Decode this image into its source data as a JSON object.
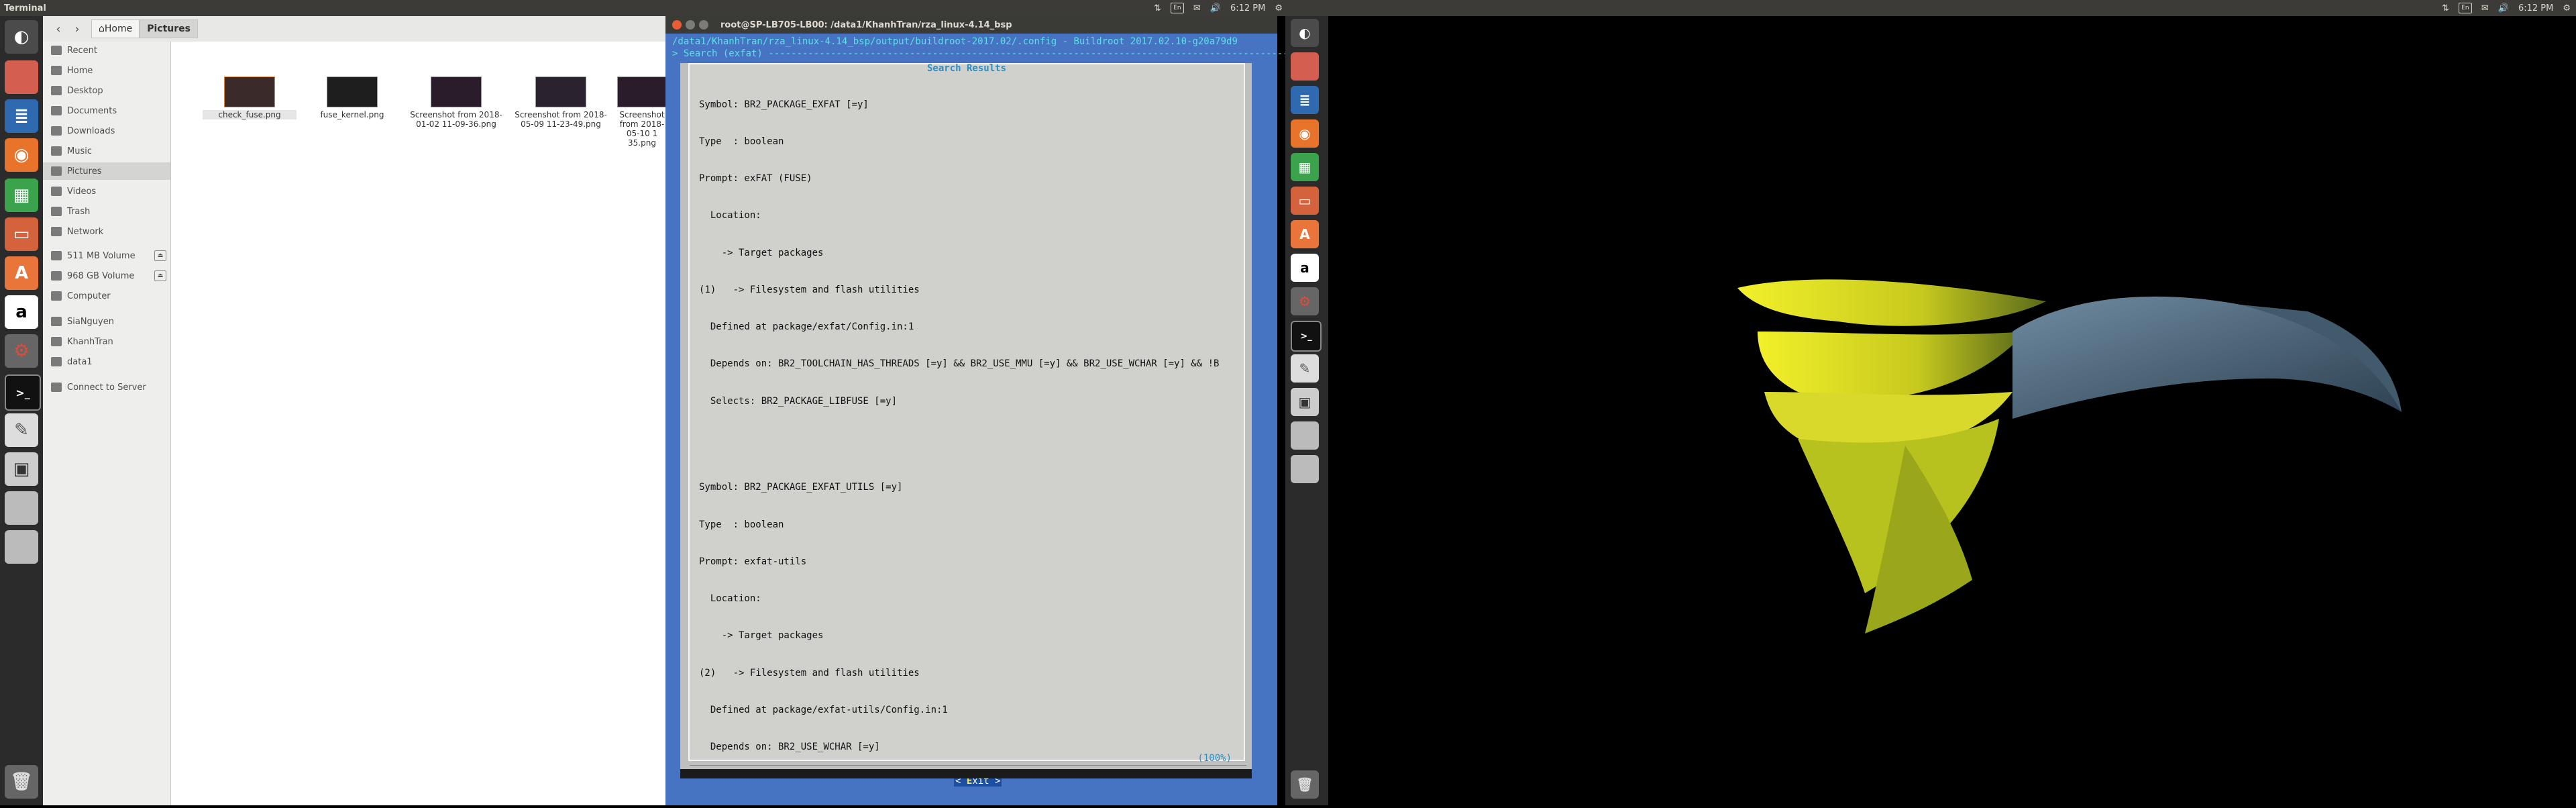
{
  "panels": {
    "left": {
      "title": "Terminal",
      "time": "6:12 PM",
      "lang": "En"
    },
    "right": {
      "time": "6:12 PM",
      "lang": "En"
    }
  },
  "files": {
    "breadcrumbs": [
      "Home",
      "Pictures"
    ],
    "sidebar": [
      {
        "label": "Recent"
      },
      {
        "label": "Home"
      },
      {
        "label": "Desktop"
      },
      {
        "label": "Documents"
      },
      {
        "label": "Downloads"
      },
      {
        "label": "Music"
      },
      {
        "label": "Pictures"
      },
      {
        "label": "Videos"
      },
      {
        "label": "Trash"
      },
      {
        "label": "Network"
      },
      {
        "label": "511 MB Volume"
      },
      {
        "label": "968 GB Volume"
      },
      {
        "label": "Computer"
      },
      {
        "label": "SiaNguyen"
      },
      {
        "label": "KhanhTran"
      },
      {
        "label": "data1"
      },
      {
        "label": "Connect to Server"
      }
    ],
    "items": [
      {
        "name": "check_fuse.png"
      },
      {
        "name": "fuse_kernel.png"
      },
      {
        "name": "Screenshot from 2018-01-02 11-09-36.png"
      },
      {
        "name": "Screenshot from 2018-05-09 11-23-49.png"
      },
      {
        "name": "Screenshot from 2018-05-10 1 35.png"
      }
    ]
  },
  "terminal": {
    "title": "root@SP-LB705-LB00: /data1/KhanhTran/rza_linux-4.14_bsp",
    "path_line": "/data1/KhanhTran/rza_linux-4.14_bsp/output/buildroot-2017.02/.config - Buildroot 2017.02.10-g20a79d9",
    "search_line": "> Search (exfat) ---------------------------------------------------------------------------------------------------",
    "dialog_title": "Search Results",
    "results": [
      "Symbol: BR2_PACKAGE_EXFAT [=y]",
      "Type  : boolean",
      "Prompt: exFAT (FUSE)",
      "  Location:",
      "    -> Target packages",
      "(1)   -> Filesystem and flash utilities",
      "  Defined at package/exfat/Config.in:1",
      "  Depends on: BR2_TOOLCHAIN_HAS_THREADS [=y] && BR2_USE_MMU [=y] && BR2_USE_WCHAR [=y] && !B",
      "  Selects: BR2_PACKAGE_LIBFUSE [=y]",
      "",
      "",
      "Symbol: BR2_PACKAGE_EXFAT_UTILS [=y]",
      "Type  : boolean",
      "Prompt: exfat-utils",
      "  Location:",
      "    -> Target packages",
      "(2)   -> Filesystem and flash utilities",
      "  Defined at package/exfat-utils/Config.in:1",
      "  Depends on: BR2_USE_WCHAR [=y]"
    ],
    "percent": "(100%)",
    "exit_prefix": "< ",
    "exit_hot": "E",
    "exit_rest": "xit >"
  }
}
